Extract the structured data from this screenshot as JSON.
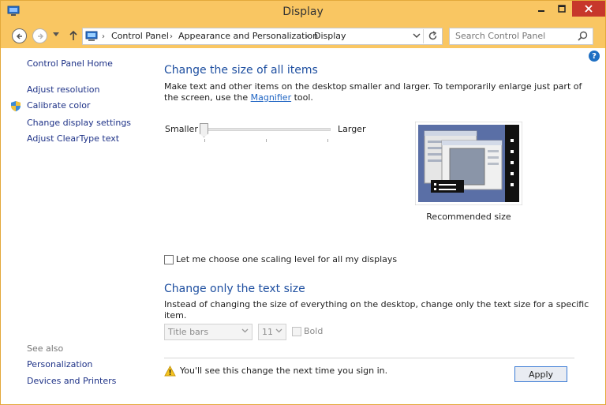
{
  "window": {
    "title": "Display"
  },
  "address": {
    "crumbs": [
      "Control Panel",
      "Appearance and Personalization",
      "Display"
    ]
  },
  "search": {
    "placeholder": "Search Control Panel"
  },
  "sidebar": {
    "home": "Control Panel Home",
    "tasks": [
      "Adjust resolution",
      "Calibrate color",
      "Change display settings",
      "Adjust ClearType text"
    ],
    "see_also_title": "See also",
    "see_also": [
      "Personalization",
      "Devices and Printers"
    ]
  },
  "main": {
    "heading1": "Change the size of all items",
    "desc1_before": "Make text and other items on the desktop smaller and larger. To temporarily enlarge just part of the screen, use the ",
    "desc1_link": "Magnifier",
    "desc1_after": " tool.",
    "slider": {
      "min_label": "Smaller",
      "max_label": "Larger",
      "position": 0
    },
    "preview_caption": "Recommended size",
    "scaling_checkbox": {
      "label": "Let me choose one scaling level for all my displays",
      "checked": false
    },
    "heading2": "Change only the text size",
    "desc2": "Instead of changing the size of everything on the desktop, change only the text size for a specific item.",
    "text_item_select": "Title bars",
    "text_size_select": "11",
    "bold": {
      "label": "Bold",
      "checked": false
    },
    "warning": "You'll see this change the next time you sign in.",
    "apply": "Apply"
  },
  "icons": [
    "app-icon",
    "minimize-icon",
    "maximize-icon",
    "close-icon",
    "back-icon",
    "forward-icon",
    "chevron-down-icon",
    "up-arrow-icon",
    "computer-icon",
    "refresh-icon",
    "search-icon",
    "shield-icon",
    "help-icon",
    "warning-icon"
  ],
  "colors": {
    "titlebar": "#f9c662",
    "close": "#c7372b",
    "link": "#1e3287",
    "heading": "#1e4fa0",
    "help": "#1e6fc3"
  }
}
